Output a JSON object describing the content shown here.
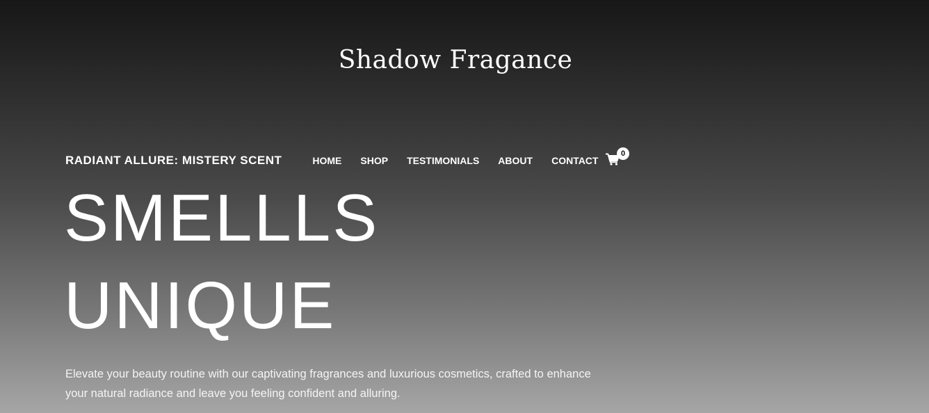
{
  "brand": {
    "name": "Shadow Fragance"
  },
  "header": {
    "site_title": "RADIANT ALLURE: MISTERY SCENT",
    "nav": [
      {
        "label": "HOME"
      },
      {
        "label": "SHOP"
      },
      {
        "label": "TESTIMONIALS"
      },
      {
        "label": "ABOUT"
      },
      {
        "label": "CONTACT"
      }
    ],
    "cart": {
      "icon": "cart-icon",
      "count": "0"
    }
  },
  "hero": {
    "line1": "SMELLLS",
    "line2": "UNIQUE",
    "description": "Elevate your beauty routine with our captivating fragrances and luxurious cosmetics, crafted to enhance your natural radiance and leave you feeling confident and alluring."
  },
  "colors": {
    "gradient_top": "#171717",
    "gradient_bottom": "#a6a6a6",
    "text": "#ffffff"
  }
}
